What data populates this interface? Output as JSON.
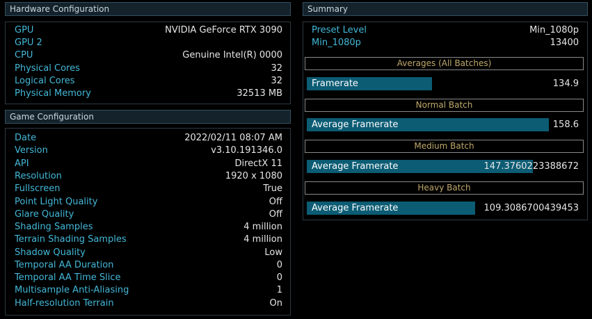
{
  "hardware": {
    "title": "Hardware Configuration",
    "rows": [
      {
        "k": "GPU",
        "v": "NVIDIA GeForce RTX 3090"
      },
      {
        "k": "GPU 2",
        "v": ""
      },
      {
        "k": "CPU",
        "v": "Genuine Intel(R) 0000"
      },
      {
        "k": "Physical Cores",
        "v": "32"
      },
      {
        "k": "Logical Cores",
        "v": "32"
      },
      {
        "k": "Physical Memory",
        "v": "32513 MB"
      }
    ]
  },
  "game": {
    "title": "Game Configuration",
    "rows": [
      {
        "k": "Date",
        "v": "2022/02/11 08:07 AM"
      },
      {
        "k": "Version",
        "v": "v3.10.191346.0"
      },
      {
        "k": "API",
        "v": "DirectX 11"
      },
      {
        "k": "Resolution",
        "v": "1920 x 1080"
      },
      {
        "k": "Fullscreen",
        "v": "True"
      },
      {
        "k": "Point Light Quality",
        "v": "Off"
      },
      {
        "k": "Glare Quality",
        "v": "Off"
      },
      {
        "k": "Shading Samples",
        "v": "4 million"
      },
      {
        "k": "Terrain Shading Samples",
        "v": "4 million"
      },
      {
        "k": "Shadow Quality",
        "v": "Low"
      },
      {
        "k": "Temporal AA Duration",
        "v": "0"
      },
      {
        "k": "Temporal AA Time Slice",
        "v": "0"
      },
      {
        "k": "Multisample Anti-Aliasing",
        "v": "1"
      },
      {
        "k": "Half-resolution Terrain",
        "v": "On"
      }
    ]
  },
  "summary": {
    "title": "Summary",
    "rows": [
      {
        "k": "Preset Level",
        "v": "Min_1080p"
      },
      {
        "k": "Min_1080p",
        "v": "13400"
      }
    ],
    "batches": [
      {
        "heading": "Averages (All Batches)",
        "label": "Framerate",
        "value": "134.9",
        "fill_fraction": 0.46
      },
      {
        "heading": "Normal Batch",
        "label": "Average Framerate",
        "value": "158.6",
        "fill_fraction": 0.89
      },
      {
        "heading": "Medium Batch",
        "label": "Average Framerate",
        "value": "147.3760223388672",
        "fill_fraction": 0.83
      },
      {
        "heading": "Heavy Batch",
        "label": "Average Framerate",
        "value": "109.3086700439453",
        "fill_fraction": 0.62
      }
    ]
  },
  "colors": {
    "background": "#000000",
    "header_bg": "#14222b",
    "key_text": "#43b8d8",
    "value_text": "#e6e6e6",
    "bar_fill": "#0c5c74",
    "batch_heading": "#bfa86a"
  }
}
